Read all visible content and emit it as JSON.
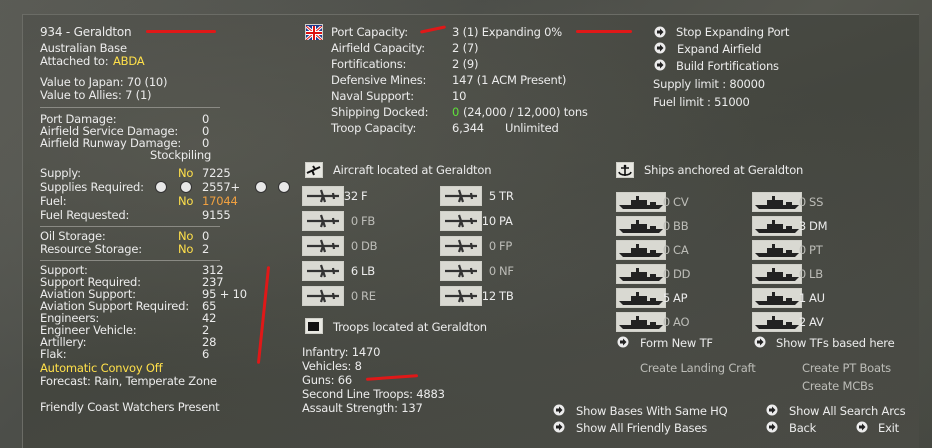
{
  "base": {
    "title": "934 - Geraldton",
    "type": "Australian Base",
    "attached_label": "Attached to:",
    "attached_value": "ABDA",
    "value_japan": "Value to Japan: 70 (10)",
    "value_allies": "Value to Allies: 7 (1)",
    "port_damage_label": "Port Damage:",
    "port_damage_value": "0",
    "airfield_service_label": "Airfield Service Damage:",
    "airfield_service_value": "0",
    "airfield_runway_label": "Airfield Runway Damage:",
    "airfield_runway_value": "0",
    "stockpiling": "Stockpiling",
    "supply_label": "Supply:",
    "supply_flag": "No",
    "supply_value": "7225",
    "supplies_req_label": "Supplies Required:",
    "supplies_req_value": "2557+",
    "fuel_label": "Fuel:",
    "fuel_flag": "No",
    "fuel_value": "17044",
    "fuel_req_label": "Fuel Requested:",
    "fuel_req_value": "9155",
    "oil_label": "Oil Storage:",
    "oil_flag": "No",
    "oil_value": "0",
    "resource_label": "Resource Storage:",
    "resource_flag": "No",
    "resource_value": "2",
    "support_label": "Support:",
    "support_value": "312",
    "support_req_label": "Support Required:",
    "support_req_value": "237",
    "av_support_label": "Aviation Support:",
    "av_support_value": "95 + 10",
    "av_support_req_label": "Aviation Support Required:",
    "av_support_req_value": "65",
    "engineers_label": "Engineers:",
    "engineers_value": "42",
    "eng_vehicle_label": "Engineer Vehicle:",
    "eng_vehicle_value": "2",
    "artillery_label": "Artillery:",
    "artillery_value": "28",
    "flak_label": "Flak:",
    "flak_value": "6",
    "convoy": "Automatic Convoy Off",
    "forecast": "Forecast: Rain, Temperate Zone",
    "coast_watchers": "Friendly Coast Watchers Present"
  },
  "capacity": {
    "port_label": "Port Capacity:",
    "port_value": "3 (1) Expanding 0%",
    "airfield_label": "Airfield Capacity:",
    "airfield_value": "2 (7)",
    "fort_label": "Fortifications:",
    "fort_value": "2 (9)",
    "mines_label": "Defensive Mines:",
    "mines_value": "147 (1 ACM Present)",
    "naval_label": "Naval Support:",
    "naval_value": "10",
    "shipping_label": "Shipping Docked:",
    "shipping_zero": "0",
    "shipping_value": "(24,000 / 12,000) tons",
    "troop_label": "Troop Capacity:",
    "troop_value": "6,344",
    "troop_unlimited": "Unlimited"
  },
  "actions": {
    "stop_expanding": "Stop Expanding Port",
    "expand_airfield": "Expand Airfield",
    "build_fort": "Build Fortifications",
    "supply_limit": "Supply limit : 80000",
    "fuel_limit": "Fuel limit : 51000"
  },
  "aircraft": {
    "header": "Aircraft located at Geraldton",
    "left": [
      {
        "count": "32",
        "code": "F"
      },
      {
        "count": "0",
        "code": "FB"
      },
      {
        "count": "0",
        "code": "DB"
      },
      {
        "count": "6",
        "code": "LB"
      },
      {
        "count": "0",
        "code": "RE"
      }
    ],
    "right": [
      {
        "count": "5",
        "code": "TR"
      },
      {
        "count": "10",
        "code": "PA"
      },
      {
        "count": "0",
        "code": "FP"
      },
      {
        "count": "0",
        "code": "NF"
      },
      {
        "count": "12",
        "code": "TB"
      }
    ]
  },
  "ships": {
    "header": "Ships anchored at Geraldton",
    "left": [
      {
        "count": "0",
        "code": "CV"
      },
      {
        "count": "0",
        "code": "BB"
      },
      {
        "count": "0",
        "code": "CA"
      },
      {
        "count": "0",
        "code": "DD"
      },
      {
        "count": "5",
        "code": "AP"
      },
      {
        "count": "0",
        "code": "AO"
      }
    ],
    "right": [
      {
        "count": "0",
        "code": "SS"
      },
      {
        "count": "3",
        "code": "DM"
      },
      {
        "count": "0",
        "code": "PT"
      },
      {
        "count": "0",
        "code": "LB"
      },
      {
        "count": "1",
        "code": "AU"
      },
      {
        "count": "2",
        "code": "AV"
      }
    ],
    "form_tf": "Form New TF",
    "show_tfs": "Show TFs based here",
    "create_landing": "Create Landing Craft",
    "create_pt": "Create PT Boats",
    "create_mcb": "Create MCBs"
  },
  "troops": {
    "header": "Troops located at Geraldton",
    "infantry": "Infantry: 1470",
    "vehicles": "Vehicles: 8",
    "guns": "Guns: 66",
    "second_line": "Second Line Troops: 4883",
    "assault": "Assault Strength: 137"
  },
  "nav": {
    "show_same_hq": "Show Bases With Same HQ",
    "show_friendly": "Show All Friendly Bases",
    "show_search": "Show All Search Arcs",
    "back": "Back",
    "exit": "Exit"
  },
  "colors": {
    "highlight_yellow": "#ffe04a",
    "fuel_orange": "#f0a040",
    "docked_green": "#5fe03a",
    "annotation_red": "#e01818"
  }
}
